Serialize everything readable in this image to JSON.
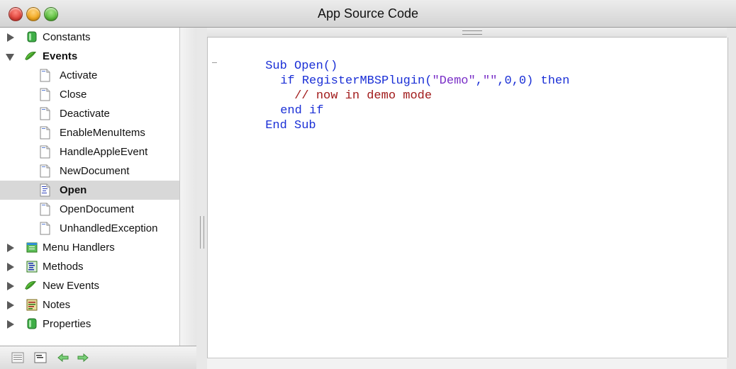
{
  "window": {
    "title": "App Source Code"
  },
  "sidebar": {
    "items": [
      {
        "label": "Constants",
        "icon": "constants-icon",
        "expanded": false
      },
      {
        "label": "Events",
        "icon": "events-icon",
        "expanded": true
      },
      {
        "label": "Activate",
        "icon": "document-icon"
      },
      {
        "label": "Close",
        "icon": "document-icon"
      },
      {
        "label": "Deactivate",
        "icon": "document-icon"
      },
      {
        "label": "EnableMenuItems",
        "icon": "document-icon"
      },
      {
        "label": "HandleAppleEvent",
        "icon": "document-icon"
      },
      {
        "label": "NewDocument",
        "icon": "document-icon"
      },
      {
        "label": "Open",
        "icon": "document-code-icon",
        "selected": true
      },
      {
        "label": "OpenDocument",
        "icon": "document-icon"
      },
      {
        "label": "UnhandledException",
        "icon": "document-icon"
      },
      {
        "label": "Menu Handlers",
        "icon": "menu-handlers-icon",
        "expanded": false
      },
      {
        "label": "Methods",
        "icon": "methods-icon",
        "expanded": false
      },
      {
        "label": "New Events",
        "icon": "new-events-icon",
        "expanded": false
      },
      {
        "label": "Notes",
        "icon": "notes-icon",
        "expanded": false
      },
      {
        "label": "Properties",
        "icon": "properties-icon",
        "expanded": false
      }
    ]
  },
  "toolbar": {
    "buttons": [
      "view-list-icon",
      "view-code-icon",
      "back-arrow-icon",
      "forward-arrow-icon"
    ]
  },
  "code": {
    "line1_kw": "Sub",
    "line1_text": " Open()",
    "line2_kw": "if",
    "line2_fn": " RegisterMBSPlugin(",
    "line2_str1": "\"Demo\"",
    "line2_comma1": ",",
    "line2_str2": "\"\"",
    "line2_comma2": ",",
    "line2_n1": "0",
    "line2_comma3": ",",
    "line2_n2": "0",
    "line2_close": ")",
    "line2_then": " then",
    "line3_comment": "// now in demo mode",
    "line4_kw": "end if",
    "line5_kw": "End Sub"
  },
  "colors": {
    "keyword": "#1a2fd6",
    "string": "#7a2fc7",
    "comment": "#a11b1b",
    "selection": "#d8d8d8"
  }
}
